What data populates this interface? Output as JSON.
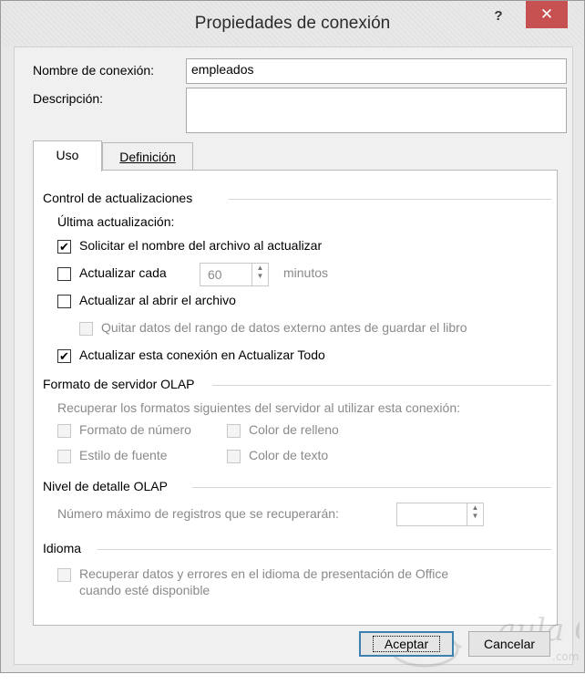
{
  "window": {
    "title": "Propiedades de conexión",
    "help_label": "?",
    "close_label": "✕"
  },
  "connection": {
    "name_label": "Nombre de conexión:",
    "name_value": "empleados",
    "desc_label": "Descripción:",
    "desc_value": ""
  },
  "tabs": [
    {
      "label": "Uso",
      "active": true
    },
    {
      "label": "Definición",
      "active": false
    }
  ],
  "updates": {
    "section_title": "Control de actualizaciones",
    "last_update_label": "Última actualización:",
    "prompt_filename": {
      "label": "Solicitar el nombre del archivo al actualizar",
      "checked": true
    },
    "refresh_every": {
      "label": "Actualizar cada",
      "checked": false,
      "value": "60",
      "unit": "minutos"
    },
    "refresh_on_open": {
      "label": "Actualizar al abrir el archivo",
      "checked": false
    },
    "remove_external": {
      "label": "Quitar datos del rango de datos externo antes de guardar el libro",
      "checked": false,
      "disabled": true
    },
    "refresh_all": {
      "label": "Actualizar esta conexión en Actualizar Todo",
      "checked": true
    }
  },
  "olap_format": {
    "section_title": "Formato de servidor OLAP",
    "description": "Recuperar los formatos siguientes del servidor al utilizar esta conexión:",
    "number_format": "Formato de número",
    "fill_color": "Color de relleno",
    "font_style": "Estilo de fuente",
    "text_color": "Color de texto"
  },
  "olap_detail": {
    "section_title": "Nivel de detalle OLAP",
    "max_records_label": "Número máximo de registros que se recuperarán:",
    "max_records_value": ""
  },
  "language": {
    "section_title": "Idioma",
    "retrieve_label_line1": "Recuperar datos y errores en el idioma de presentación de Office",
    "retrieve_label_line2": "cuando esté disponible"
  },
  "buttons": {
    "ok": "Aceptar",
    "cancel": "Cancelar"
  },
  "watermark": {
    "text": "aula Clic",
    "small": ".com"
  },
  "colors": {
    "close_button": "#c75050",
    "default_button_border": "#3c7fb1"
  }
}
